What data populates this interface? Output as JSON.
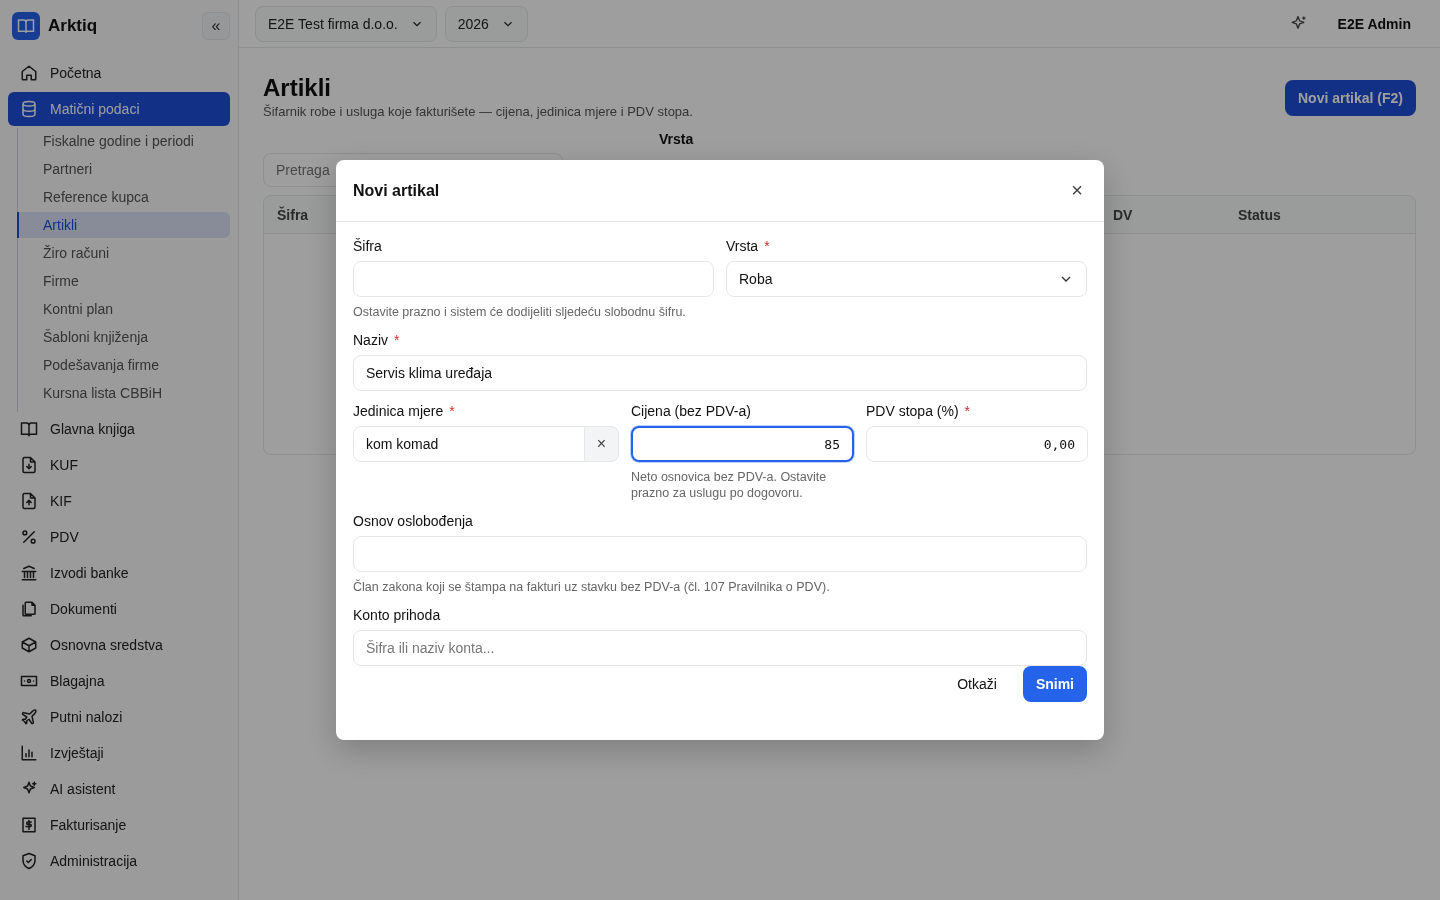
{
  "app": {
    "name": "Arktiq",
    "collapse": "«"
  },
  "sidebar": {
    "items": [
      {
        "label": "Početna",
        "selected": false
      },
      {
        "label": "Matični podaci",
        "selected": true,
        "expanded": true,
        "children": [
          {
            "label": "Fiskalne godine i periodi",
            "selected": false
          },
          {
            "label": "Partneri",
            "selected": false
          },
          {
            "label": "Reference kupca",
            "selected": false
          },
          {
            "label": "Artikli",
            "selected": true
          },
          {
            "label": "Žiro računi",
            "selected": false
          },
          {
            "label": "Firme",
            "selected": false
          },
          {
            "label": "Kontni plan",
            "selected": false
          },
          {
            "label": "Šabloni knjiženja",
            "selected": false
          },
          {
            "label": "Podešavanja firme",
            "selected": false
          },
          {
            "label": "Kursna lista CBBiH",
            "selected": false
          }
        ]
      },
      {
        "label": "Glavna knjiga",
        "selected": false
      },
      {
        "label": "KUF",
        "selected": false
      },
      {
        "label": "KIF",
        "selected": false
      },
      {
        "label": "PDV",
        "selected": false
      },
      {
        "label": "Izvodi banke",
        "selected": false
      },
      {
        "label": "Dokumenti",
        "selected": false
      },
      {
        "label": "Osnovna sredstva",
        "selected": false
      },
      {
        "label": "Blagajna",
        "selected": false
      },
      {
        "label": "Putni nalozi",
        "selected": false
      },
      {
        "label": "Izvještaji",
        "selected": false
      },
      {
        "label": "AI asistent",
        "selected": false
      },
      {
        "label": "Fakturisanje",
        "selected": false
      },
      {
        "label": "Administracija",
        "selected": false
      }
    ]
  },
  "topbar": {
    "company": "E2E Test firma d.o.o.",
    "year": "2026",
    "user": "E2E Admin"
  },
  "page": {
    "title": "Artikli",
    "subtitle": "Šifarnik robe i usluga koje fakturišete — cijena, jedinica mjere i PDV stopa.",
    "new_button": "Novi artikal (F2)",
    "search_placeholder": "Pretraga",
    "filter_label": "Vrsta",
    "table": {
      "columns": [
        {
          "label": "Šifra"
        },
        {
          "label": "DV"
        },
        {
          "label": "Status"
        }
      ]
    }
  },
  "modal": {
    "title": "Novi artikal",
    "close": "×",
    "required_mark": "*",
    "sifra": {
      "label": "Šifra",
      "required": false,
      "hint": "Ostavite prazno i sistem će dodijeliti sljedeću slobodnu šifru."
    },
    "vrsta": {
      "label": "Vrsta",
      "required": true,
      "value": "Roba"
    },
    "naziv": {
      "label": "Naziv",
      "required": true,
      "value": "Servis klima uređaja"
    },
    "jedinica": {
      "label": "Jedinica mjere",
      "required": true,
      "value": "kom komad",
      "clear": "×"
    },
    "cijena": {
      "label": "Cijena (bez PDV-a)",
      "required": false,
      "value": "85",
      "focused": true,
      "hint": "Neto osnovica bez PDV-a. Ostavite prazno za uslugu po dogovoru."
    },
    "pdv": {
      "label": "PDV stopa (%)",
      "required": true,
      "value": "0,00",
      "focused": false
    },
    "osnov": {
      "label": "Osnov oslobođenja",
      "required": false,
      "hint": "Član zakona koji se štampa na fakturi uz stavku bez PDV-a (čl. 107 Pravilnika o PDV)."
    },
    "konto": {
      "label": "Konto prihoda",
      "required": false,
      "placeholder": "Šifra ili naziv konta..."
    },
    "cancel": "Otkaži",
    "save": "Snimi"
  }
}
